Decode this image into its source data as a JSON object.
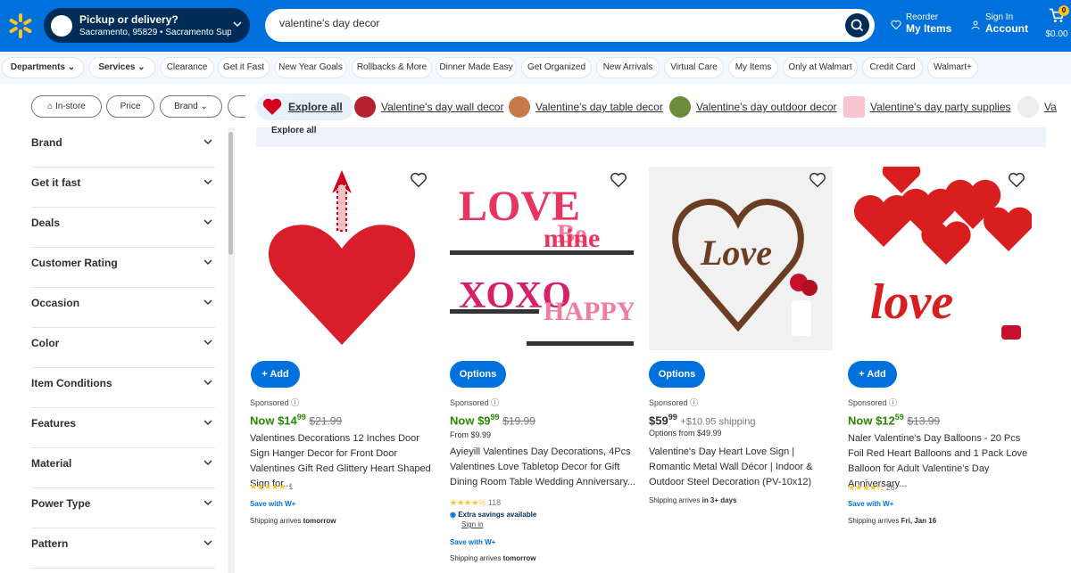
{
  "header": {
    "pickup_title": "Pickup or delivery?",
    "pickup_location": "Sacramento, 95829 • Sacramento Supe...",
    "search_value": "valentine's day decor",
    "reorder_top": "Reorder",
    "reorder_bottom": "My Items",
    "signin_top": "Sign In",
    "signin_bottom": "Account",
    "cart_count": "0",
    "cart_total": "$0.00"
  },
  "nav": {
    "items": [
      "Departments",
      "Services",
      "Clearance",
      "Get it Fast",
      "New Year Goals",
      "Rollbacks & More",
      "Dinner Made Easy",
      "Get Organized",
      "New Arrivals",
      "Virtual Care",
      "My Items",
      "Only at Walmart",
      "Credit Card",
      "Walmart+"
    ]
  },
  "filters": {
    "items": [
      "In-store",
      "Price",
      "Brand"
    ]
  },
  "categories": [
    "Explore all",
    "Valentine's day wall decor",
    "Valentine's day table decor",
    "Valentine's day outdoor decor",
    "Valentine's day party supplies",
    "Va"
  ],
  "sidebar": {
    "items": [
      "Brand",
      "Get it fast",
      "Deals",
      "Customer Rating",
      "Occasion",
      "Color",
      "Item Conditions",
      "Features",
      "Material",
      "Power Type",
      "Pattern"
    ]
  },
  "band_label": "Explore all",
  "products": [
    {
      "button": "+ Add",
      "sponsored": "Sponsored",
      "now": "Now",
      "dollars": "$14",
      "cents": "99",
      "was": "$21.99",
      "title": "Valentines Decorations 12 Inches Door Sign Hanger Decor for Front Door Valentines Gift Red Glittery Heart Shaped Sign for...",
      "stars": "★★★★★",
      "reviews": "1",
      "saveWith": "Save with W+",
      "ship_prefix": "Shipping arrives ",
      "ship_day": "tomorrow"
    },
    {
      "button": "Options",
      "sponsored": "Sponsored",
      "now": "Now",
      "dollars": "$9",
      "cents": "99",
      "was": "$19.99",
      "from": "From $9.99",
      "title": "Ayieyill Valentines Day Decorations, 4Pcs Valentines Love Tabletop Decor for Gift Dining Room Table Wedding Anniversary...",
      "stars": "★★★★½",
      "reviews": "118",
      "extra": "Extra savings available",
      "signin": "Sign in",
      "saveWith": "Save with W+",
      "ship_prefix": "Shipping arrives ",
      "ship_day": "tomorrow"
    },
    {
      "button": "Options",
      "sponsored": "Sponsored",
      "dollars": "$59",
      "cents": "99",
      "shipping": "+$10.95 shipping",
      "from": "Options from $49.99",
      "title": "Valentine's Day Heart Love Sign | Romantic Metal Wall Décor | Indoor & Outdoor Steel Decoration (PV-10x12)",
      "ship_prefix": "Shipping arrives ",
      "ship_day": "in 3+ days"
    },
    {
      "button": "+ Add",
      "sponsored": "Sponsored",
      "now": "Now",
      "dollars": "$12",
      "cents": "59",
      "was": "$13.99",
      "title": "Naler Valentine's Day Balloons - 20 Pcs Foil Red Heart Balloons and 1 Pack Love Balloon for Adult Valentine's Day Anniversary...",
      "stars": "★★★★½",
      "reviews": "26",
      "saveWith": "Save with W+",
      "ship_prefix": "Shipping arrives ",
      "ship_day": "Fri, Jan 16"
    }
  ]
}
